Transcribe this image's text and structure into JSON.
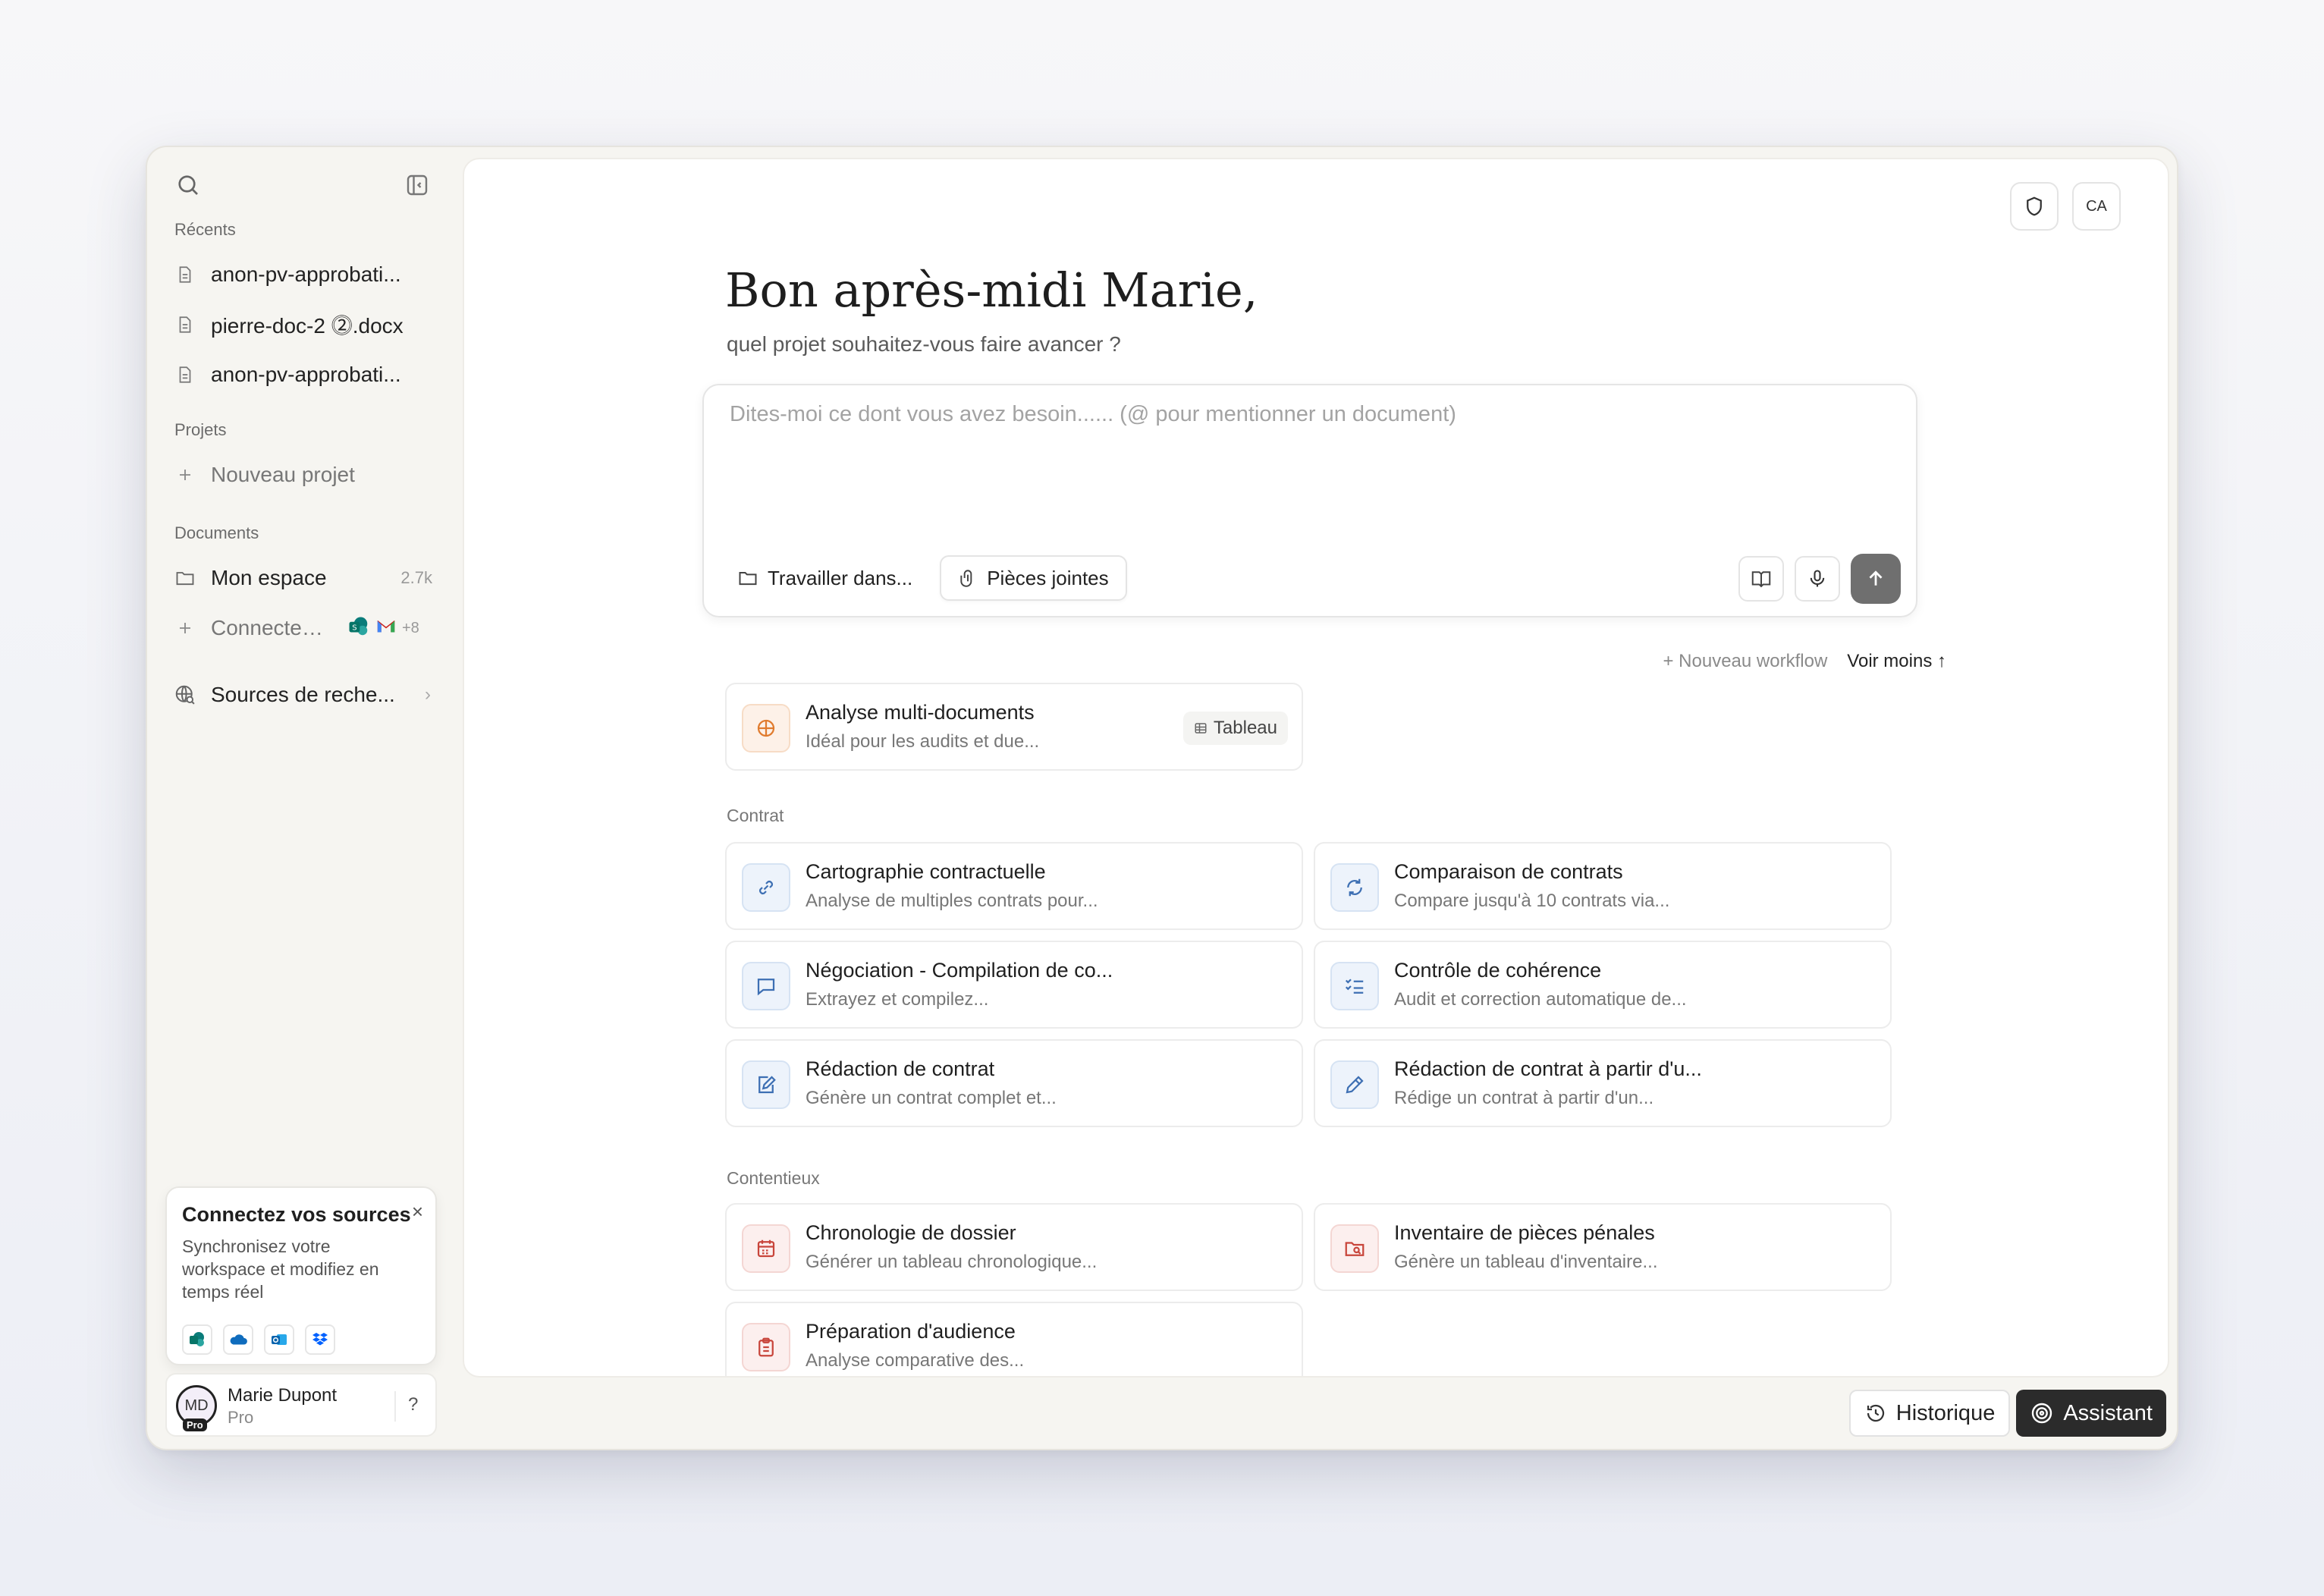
{
  "sidebar": {
    "recents_label": "Récents",
    "recents": [
      {
        "label": "anon-pv-approbati..."
      },
      {
        "label": "pierre-doc-2 ⓶.docx"
      },
      {
        "label": "anon-pv-approbati..."
      }
    ],
    "projects_label": "Projets",
    "new_project": "Nouveau projet",
    "documents_label": "Documents",
    "my_space": {
      "label": "Mon espace",
      "size": "2.7k"
    },
    "connect": {
      "label": "Connecter ...",
      "extra": "+8"
    },
    "research_sources": "Sources de reche..."
  },
  "promo": {
    "title": "Connectez vos sources",
    "text": "Synchronisez votre workspace et modifiez en temps réel",
    "close": "×"
  },
  "user": {
    "initials": "MD",
    "badge": "Pro",
    "name": "Marie Dupont",
    "plan": "Pro",
    "help": "?"
  },
  "header": {
    "avatar_initials": "CA"
  },
  "greeting": {
    "title": "Bon après-midi Marie,",
    "subtitle": "quel projet souhaitez-vous faire avancer ?"
  },
  "composer": {
    "placeholder": "Dites-moi ce dont vous avez besoin...... (@ pour mentionner un document)",
    "work_in": "Travailler dans...",
    "attachments": "Pièces jointes"
  },
  "workflows": {
    "new_workflow": "+ Nouveau workflow",
    "show_less": "Voir moins ↑",
    "featured": {
      "title": "Analyse multi-documents",
      "desc": "Idéal pour les audits et due...",
      "tag": "Tableau"
    },
    "contract_label": "Contrat",
    "contract": [
      {
        "title": "Cartographie contractuelle",
        "desc": "Analyse de multiples contrats pour..."
      },
      {
        "title": "Comparaison de contrats",
        "desc": "Compare jusqu'à 10 contrats via..."
      },
      {
        "title": "Négociation - Compilation de co...",
        "desc": "Extrayez et compilez..."
      },
      {
        "title": "Contrôle de cohérence",
        "desc": "Audit et correction automatique de..."
      },
      {
        "title": "Rédaction de contrat",
        "desc": "Génère un contrat complet et..."
      },
      {
        "title": "Rédaction de contrat à partir d'u...",
        "desc": "Rédige un contrat à partir d'un..."
      }
    ],
    "litigation_label": "Contentieux",
    "litigation": [
      {
        "title": "Chronologie de dossier",
        "desc": "Générer un tableau chronologique..."
      },
      {
        "title": "Inventaire de pièces pénales",
        "desc": "Génère un tableau d'inventaire..."
      },
      {
        "title": "Préparation d'audience",
        "desc": "Analyse comparative des..."
      }
    ]
  },
  "footer": {
    "history": "Historique",
    "assistant": "Assistant"
  },
  "colors": {
    "accent_blue": "#3d6fb3",
    "accent_red": "#c8453b",
    "accent_orange": "#e07b2e",
    "send_bg": "#6f6f6f"
  }
}
